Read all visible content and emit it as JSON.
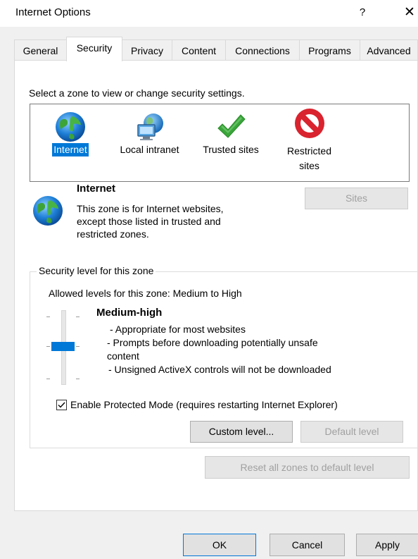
{
  "window": {
    "title": "Internet Options",
    "help_label": "?",
    "close_label": "✕"
  },
  "tabs": [
    {
      "label": "General"
    },
    {
      "label": "Security"
    },
    {
      "label": "Privacy"
    },
    {
      "label": "Content"
    },
    {
      "label": "Connections"
    },
    {
      "label": "Programs"
    },
    {
      "label": "Advanced"
    }
  ],
  "active_tab": "Security",
  "security": {
    "instruction": "Select a zone to view or change security settings.",
    "zones": [
      {
        "label": "Internet",
        "icon": "globe-icon",
        "selected": true
      },
      {
        "label": "Local intranet",
        "icon": "intranet-icon",
        "selected": false
      },
      {
        "label": "Trusted sites",
        "icon": "checkmark-icon",
        "selected": false
      },
      {
        "label_line1": "Restricted",
        "label_line2": "sites",
        "icon": "restricted-icon",
        "selected": false
      }
    ],
    "zone_info": {
      "name": "Internet",
      "desc_line1": "This zone is for Internet websites,",
      "desc_line2": "except those listed in trusted and",
      "desc_line3": "restricted zones.",
      "sites_label": "Sites"
    },
    "level_group": {
      "title": "Security level for this zone",
      "allowed": "Allowed levels for this zone: Medium to High",
      "level_name": "Medium-high",
      "bullet1": "- Appropriate for most websites",
      "bullet2": "- Prompts before downloading potentially unsafe",
      "bullet2_cont": "content",
      "bullet3": "- Unsigned ActiveX controls will not be downloaded",
      "slider_level": "Medium-high",
      "protected_mode_label": "Enable Protected Mode (requires restarting Internet Explorer)",
      "protected_mode_checked": true,
      "custom_level_label": "Custom level...",
      "default_level_label": "Default level"
    },
    "reset_label": "Reset all zones to default level"
  },
  "footer": {
    "ok_label": "OK",
    "cancel_label": "Cancel",
    "apply_label": "Apply"
  },
  "colors": {
    "accent": "#0078d7",
    "disabled_text": "#a0a0a0",
    "restricted_red": "#d9232e",
    "check_green": "#3aa63a"
  }
}
